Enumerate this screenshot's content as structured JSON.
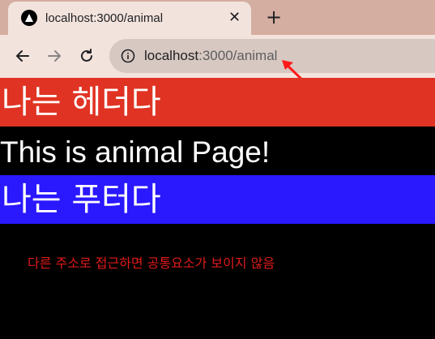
{
  "browser": {
    "tab": {
      "title": "localhost:3000/animal",
      "close_symbol": "✕"
    },
    "new_tab_symbol": "+",
    "address_bar": {
      "host": "localhost",
      "path": ":3000/animal"
    },
    "annotation_color": "#ff1a1a"
  },
  "page": {
    "header": {
      "text": "나는 헤더다",
      "background": "#e03323"
    },
    "main": {
      "text": "This is animal Page!",
      "background": "#000000"
    },
    "footer": {
      "text": "나는 푸터다",
      "background": "#2a18ff"
    },
    "note": {
      "text": "다른 주소로 접근하면 공통요소가 보이지 않음",
      "color": "#e01a1a"
    }
  }
}
